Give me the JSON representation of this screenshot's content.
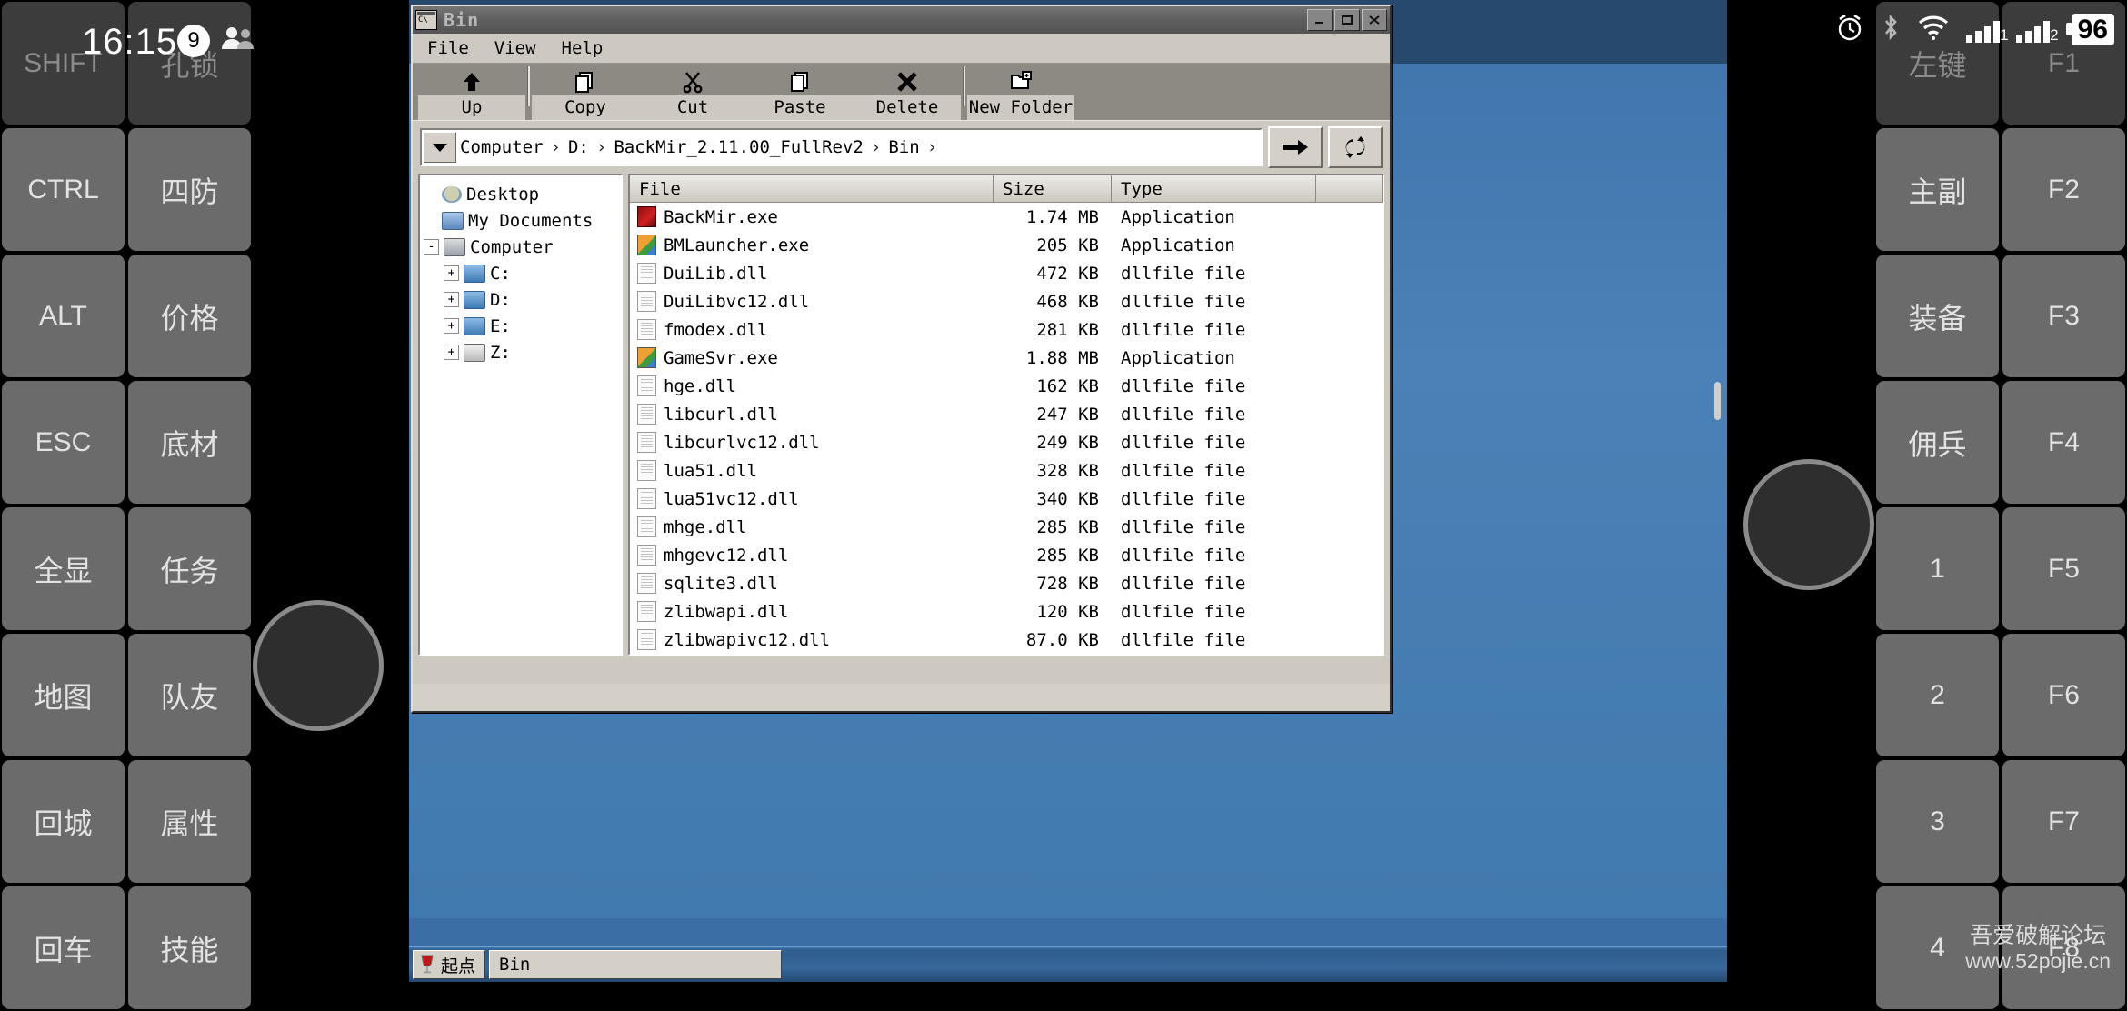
{
  "status_bar": {
    "clock": "16:15",
    "notification_count": "9",
    "people_icon": "people-icon",
    "alarm_icon": "alarm-icon",
    "bluetooth_icon": "bluetooth-icon",
    "wifi_icon": "wifi-icon",
    "sim1_label": "1",
    "sim2_label": "2",
    "battery_percent": "96"
  },
  "window": {
    "title": "Bin",
    "icon": "console-window-icon",
    "minimize": "_",
    "maximize": "□",
    "close": "✕",
    "menus": [
      "File",
      "View",
      "Help"
    ],
    "toolbar": [
      {
        "label": "Up",
        "icon": "arrow-up-icon"
      },
      {
        "label": "Copy",
        "icon": "copy-icon"
      },
      {
        "label": "Cut",
        "icon": "scissors-icon"
      },
      {
        "label": "Paste",
        "icon": "paste-icon"
      },
      {
        "label": "Delete",
        "icon": "cross-icon"
      },
      {
        "label": "New Folder",
        "icon": "new-folder-icon"
      }
    ],
    "address": {
      "dropdown_icon": "chevron-down-icon",
      "crumbs": [
        "Computer",
        "D:",
        "BackMir_2.11.00_FullRev2",
        "Bin"
      ],
      "separator": "›",
      "go_icon": "arrow-right-icon",
      "refresh_icon": "refresh-icon"
    },
    "tree": [
      {
        "label": "Desktop",
        "level": 0,
        "expander": "",
        "icon": "desktop-icon"
      },
      {
        "label": "My Documents",
        "level": 0,
        "expander": "",
        "icon": "documents-icon"
      },
      {
        "label": "Computer",
        "level": 0,
        "expander": "-",
        "icon": "computer-icon"
      },
      {
        "label": "C:",
        "level": 1,
        "expander": "+",
        "icon": "drive-icon"
      },
      {
        "label": "D:",
        "level": 1,
        "expander": "+",
        "icon": "drive-icon"
      },
      {
        "label": "E:",
        "level": 1,
        "expander": "+",
        "icon": "drive-icon"
      },
      {
        "label": "Z:",
        "level": 1,
        "expander": "+",
        "icon": "drive-gray-icon"
      }
    ],
    "columns": [
      "File",
      "Size",
      "Type"
    ],
    "files": [
      {
        "name": "BackMir.exe",
        "size": "1.74 MB",
        "type": "Application",
        "icon": "app-red-icon"
      },
      {
        "name": "BMLauncher.exe",
        "size": "205 KB",
        "type": "Application",
        "icon": "app-multi-icon"
      },
      {
        "name": "DuiLib.dll",
        "size": "472 KB",
        "type": "dllfile file",
        "icon": "dll-icon"
      },
      {
        "name": "DuiLibvc12.dll",
        "size": "468 KB",
        "type": "dllfile file",
        "icon": "dll-icon"
      },
      {
        "name": "fmodex.dll",
        "size": "281 KB",
        "type": "dllfile file",
        "icon": "dll-icon"
      },
      {
        "name": "GameSvr.exe",
        "size": "1.88 MB",
        "type": "Application",
        "icon": "app-multi-icon"
      },
      {
        "name": "hge.dll",
        "size": "162 KB",
        "type": "dllfile file",
        "icon": "dll-icon"
      },
      {
        "name": "libcurl.dll",
        "size": "247 KB",
        "type": "dllfile file",
        "icon": "dll-icon"
      },
      {
        "name": "libcurlvc12.dll",
        "size": "249 KB",
        "type": "dllfile file",
        "icon": "dll-icon"
      },
      {
        "name": "lua51.dll",
        "size": "328 KB",
        "type": "dllfile file",
        "icon": "dll-icon"
      },
      {
        "name": "lua51vc12.dll",
        "size": "340 KB",
        "type": "dllfile file",
        "icon": "dll-icon"
      },
      {
        "name": "mhge.dll",
        "size": "285 KB",
        "type": "dllfile file",
        "icon": "dll-icon"
      },
      {
        "name": "mhgevc12.dll",
        "size": "285 KB",
        "type": "dllfile file",
        "icon": "dll-icon"
      },
      {
        "name": "sqlite3.dll",
        "size": "728 KB",
        "type": "dllfile file",
        "icon": "dll-icon"
      },
      {
        "name": "zlibwapi.dll",
        "size": "120 KB",
        "type": "dllfile file",
        "icon": "dll-icon"
      },
      {
        "name": "zlibwapivc12.dll",
        "size": "87.0 KB",
        "type": "dllfile file",
        "icon": "dll-icon"
      }
    ]
  },
  "taskbar": {
    "start_icon": "wine-glass-icon",
    "start_label": "起点",
    "task_label": "Bin"
  },
  "gamepad": {
    "left_keys": [
      "SHIFT",
      "孔锁",
      "CTRL",
      "四防",
      "ALT",
      "价格",
      "ESC",
      "底材",
      "全显",
      "任务",
      "地图",
      "队友",
      "回城",
      "属性",
      "回车",
      "技能"
    ],
    "right_keys": [
      "左键",
      "F1",
      "主副",
      "F2",
      "装备",
      "F3",
      "佣兵",
      "F4",
      "1",
      "F5",
      "2",
      "F6",
      "3",
      "F7",
      "4",
      "F8"
    ],
    "left_stick": "virtual-joystick-left",
    "right_stick": "virtual-joystick-right"
  },
  "watermark": {
    "line1": "吾爱破解论坛",
    "line2": "www.52pojie.cn"
  }
}
